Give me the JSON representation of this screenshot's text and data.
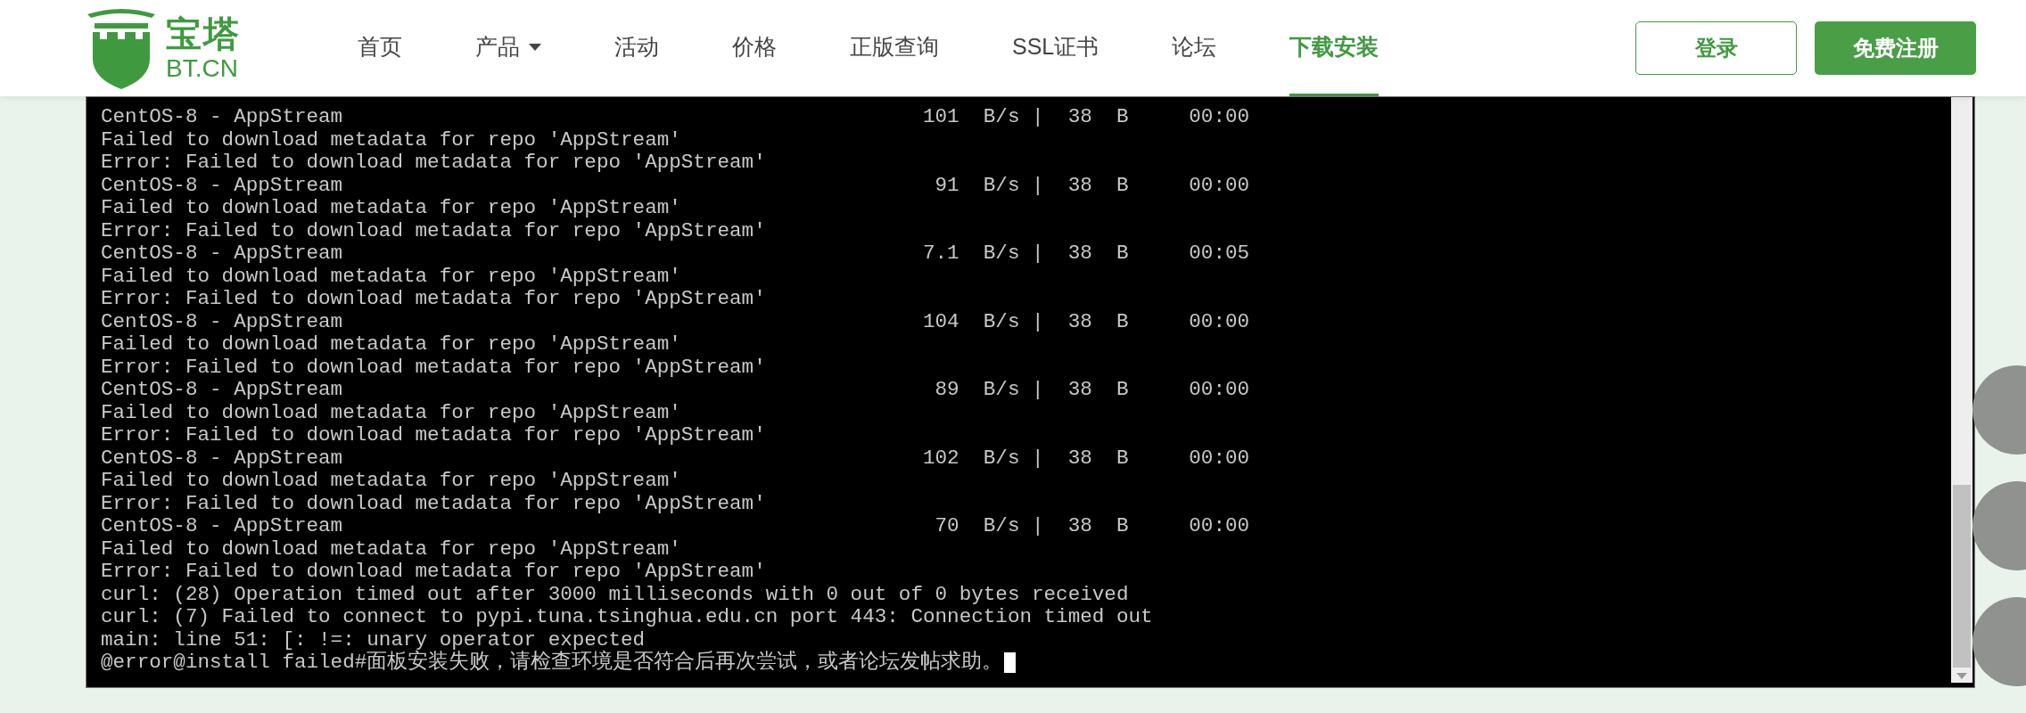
{
  "logo": {
    "title": "宝塔",
    "subtitle": "BT.CN"
  },
  "nav": [
    {
      "label": "首页",
      "selected": false,
      "dropdown": false
    },
    {
      "label": "产品",
      "selected": false,
      "dropdown": true
    },
    {
      "label": "活动",
      "selected": false,
      "dropdown": false
    },
    {
      "label": "价格",
      "selected": false,
      "dropdown": false
    },
    {
      "label": "正版查询",
      "selected": false,
      "dropdown": false
    },
    {
      "label": "SSL证书",
      "selected": false,
      "dropdown": false
    },
    {
      "label": "论坛",
      "selected": false,
      "dropdown": false
    },
    {
      "label": "下载安装",
      "selected": true,
      "dropdown": false
    }
  ],
  "auth": {
    "login": "登录",
    "register": "免费注册"
  },
  "terminal": {
    "lines": [
      "CentOS-8 - AppStream                                                101  B/s |  38  B     00:00",
      "Failed to download metadata for repo 'AppStream'",
      "Error: Failed to download metadata for repo 'AppStream'",
      "CentOS-8 - AppStream                                                 91  B/s |  38  B     00:00",
      "Failed to download metadata for repo 'AppStream'",
      "Error: Failed to download metadata for repo 'AppStream'",
      "CentOS-8 - AppStream                                                7.1  B/s |  38  B     00:05",
      "Failed to download metadata for repo 'AppStream'",
      "Error: Failed to download metadata for repo 'AppStream'",
      "CentOS-8 - AppStream                                                104  B/s |  38  B     00:00",
      "Failed to download metadata for repo 'AppStream'",
      "Error: Failed to download metadata for repo 'AppStream'",
      "CentOS-8 - AppStream                                                 89  B/s |  38  B     00:00",
      "Failed to download metadata for repo 'AppStream'",
      "Error: Failed to download metadata for repo 'AppStream'",
      "CentOS-8 - AppStream                                                102  B/s |  38  B     00:00",
      "Failed to download metadata for repo 'AppStream'",
      "Error: Failed to download metadata for repo 'AppStream'",
      "CentOS-8 - AppStream                                                 70  B/s |  38  B     00:00",
      "Failed to download metadata for repo 'AppStream'",
      "Error: Failed to download metadata for repo 'AppStream'",
      "curl: (28) Operation timed out after 3000 milliseconds with 0 out of 0 bytes received",
      "curl: (7) Failed to connect to pypi.tuna.tsinghua.edu.cn port 443: Connection timed out",
      "main: line 51: [: !=: unary operator expected",
      "@error@install failed#面板安装失败，请检查环境是否符合后再次尝试，或者论坛发帖求助。"
    ]
  }
}
